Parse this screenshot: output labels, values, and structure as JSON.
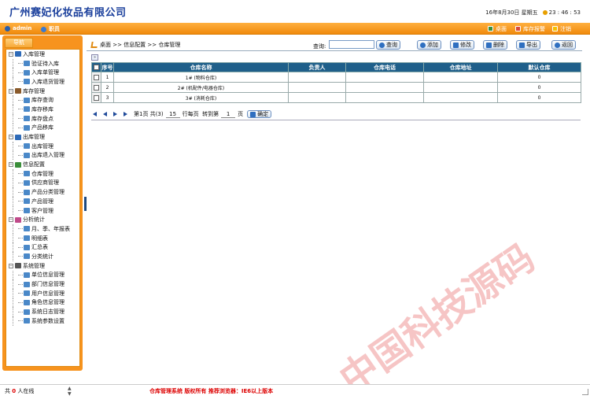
{
  "app": {
    "title": "广州赛妃化妆品有限公司",
    "date": "16年8月30日 星期五",
    "time": "23 : 46 : 53"
  },
  "topbar": {
    "user": "admin",
    "role": "职员",
    "desktop": "桌面",
    "stock_alert": "库存报警",
    "logout": "注销"
  },
  "sidebar": {
    "tab": "导航",
    "groups": [
      {
        "label": "入库管理",
        "expander": "⊟",
        "items": [
          "验证待入库",
          "入库单管理",
          "入库退货管理"
        ]
      },
      {
        "label": "库存管理",
        "expander": "⊟",
        "items": [
          "库存查询",
          "库存移库",
          "库存盘点",
          "产品移库"
        ]
      },
      {
        "label": "出库管理",
        "expander": "⊟",
        "items": [
          "出库管理",
          "出库退入管理"
        ]
      },
      {
        "label": "信息配置",
        "expander": "⊟",
        "items": [
          "仓库管理",
          "供应商管理",
          "产品分类管理",
          "产品管理",
          "客户管理"
        ]
      },
      {
        "label": "分析统计",
        "expander": "⊟",
        "items": [
          "月、季、年报表",
          "明细表",
          "汇总表",
          "分类统计"
        ]
      },
      {
        "label": "系统管理",
        "expander": "⊟",
        "items": [
          "单位信息管理",
          "部门信息管理",
          "用户信息管理",
          "角色信息管理",
          "系统日志管理",
          "系统参数设置"
        ]
      }
    ]
  },
  "breadcrumb": {
    "text": "桌面 >> 信息配置 >> 仓库管理"
  },
  "toolbar": {
    "query_label": "查询:",
    "query_value": "",
    "search": "查询",
    "add": "添加",
    "edit": "修改",
    "delete": "删除",
    "export": "导出",
    "back": "返回"
  },
  "table": {
    "columns": [
      "序号",
      "仓库名称",
      "负责人",
      "仓库电话",
      "仓库地址",
      "默认仓库"
    ],
    "rows": [
      {
        "rownum": "1",
        "seq": "1",
        "name": "1# (物料仓库)",
        "manager": "",
        "phone": "",
        "address": "",
        "default": "0"
      },
      {
        "rownum": "2",
        "seq": "2",
        "name": "2# (机配件/电器仓库)",
        "manager": "",
        "phone": "",
        "address": "",
        "default": "0"
      },
      {
        "rownum": "3",
        "seq": "3",
        "name": "3# (消耗仓库)",
        "manager": "",
        "phone": "",
        "address": "",
        "default": "0"
      }
    ]
  },
  "pager": {
    "page_info": "第1页",
    "total": "共(3)",
    "page_size": "15",
    "per_page": "行每页",
    "goto": "转到第",
    "goto_value": "1",
    "page_unit": "页",
    "confirm": "确定"
  },
  "watermark": "中国科技源码",
  "status": {
    "online_prefix": "共",
    "online_count": "0",
    "online_suffix": "人在线",
    "footer": "仓库管理系统  版权所有  推荐浏览器：IE6以上版本"
  }
}
